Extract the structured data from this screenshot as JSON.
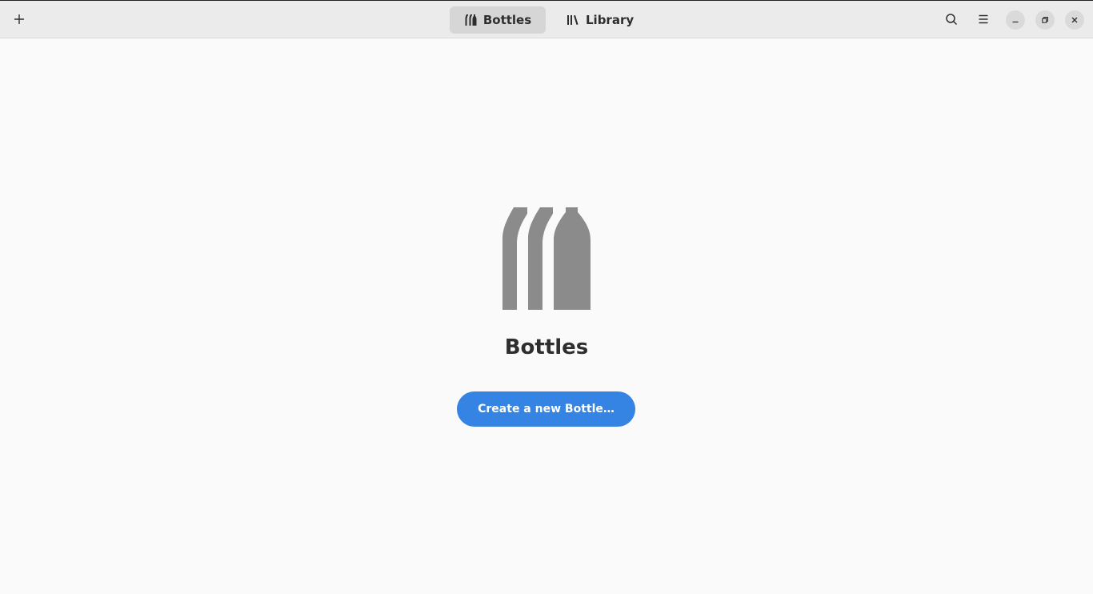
{
  "header": {
    "tabs": [
      {
        "label": "Bottles",
        "icon": "bottles-icon",
        "active": true
      },
      {
        "label": "Library",
        "icon": "library-icon",
        "active": false
      }
    ]
  },
  "status": {
    "title": "Bottles",
    "primary_action": "Create a new Bottle…"
  },
  "colors": {
    "accent": "#3584e4",
    "icon_gray": "#8b8b8b",
    "headerbar_bg": "#ebebeb"
  }
}
